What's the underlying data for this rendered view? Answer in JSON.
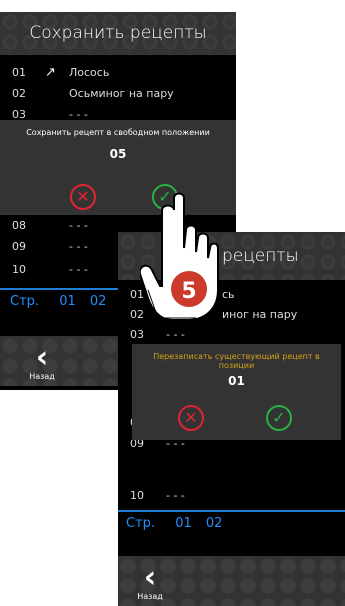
{
  "screen1": {
    "title": "Сохранить рецепты",
    "rows": [
      {
        "num": "01",
        "name": "Лосось",
        "icon": "fish-icon"
      },
      {
        "num": "02",
        "name": "Осьминог на пару"
      },
      {
        "num": "03",
        "name": "- - -"
      },
      {
        "num": "08",
        "name": "- - -"
      },
      {
        "num": "09",
        "name": "- - -"
      },
      {
        "num": "10",
        "name": "- - -"
      }
    ],
    "pager": {
      "label": "Стр.",
      "pages": [
        "01",
        "02"
      ]
    },
    "back_label": "Назад",
    "dialog": {
      "title": "Сохранить рецепт в свободном положении",
      "number": "05"
    }
  },
  "screen2": {
    "title": "ить рецепты",
    "rows": [
      {
        "num": "01",
        "name": "сь"
      },
      {
        "num": "02",
        "name": "иног на пару"
      },
      {
        "num": "03",
        "name": "- - -"
      },
      {
        "num": "08",
        "name": "- - -"
      },
      {
        "num": "09",
        "name": "- - -"
      },
      {
        "num": "10",
        "name": "- - -"
      }
    ],
    "pager": {
      "label": "Стр.",
      "pages": [
        "01",
        "02"
      ]
    },
    "back_label": "Назад",
    "dialog": {
      "title": "Перезаписать существующий рецепт в позиции",
      "number": "01",
      "title_color": "#d4a017"
    }
  },
  "badge_number": "5",
  "colors": {
    "accent": "#1e90ff",
    "cancel": "#e02433",
    "confirm": "#28b146",
    "header": "#333333"
  }
}
